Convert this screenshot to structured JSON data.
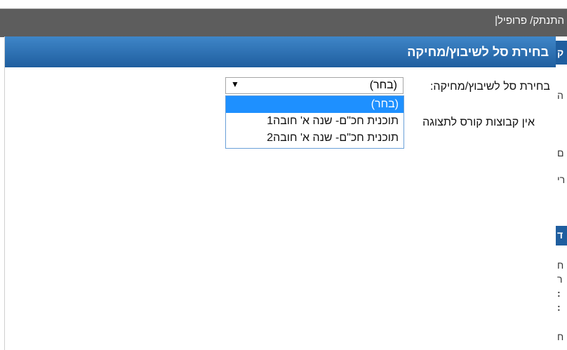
{
  "topbar": {
    "logout_label": "התנתק/",
    "profile_label": "פרופיל|"
  },
  "dialog": {
    "title": "בחירת סל לשיבוץ/מחיקה",
    "select_label": "בחירת סל לשיבוץ/מחיקה:",
    "select_value": "(בחר)",
    "options": [
      "(בחר)",
      "תוכנית חכ\"ם- שנה א' חובה1",
      "תוכנית חכ\"ם- שנה א' חובה2"
    ],
    "empty_message": "אין קבוצות קורס לתצוגה"
  },
  "background": {
    "fragments": [
      "ק",
      "ה",
      "ם",
      "רי",
      "ד",
      "ח",
      "ר",
      "ח",
      ":",
      ":",
      "ח"
    ]
  },
  "colors": {
    "header_gradient_top": "#3f86c8",
    "header_gradient_bottom": "#1f5e9f",
    "topbar": "#5d5d5d",
    "selected_option": "#1e90ff",
    "background_band": "#1f5e9f"
  }
}
